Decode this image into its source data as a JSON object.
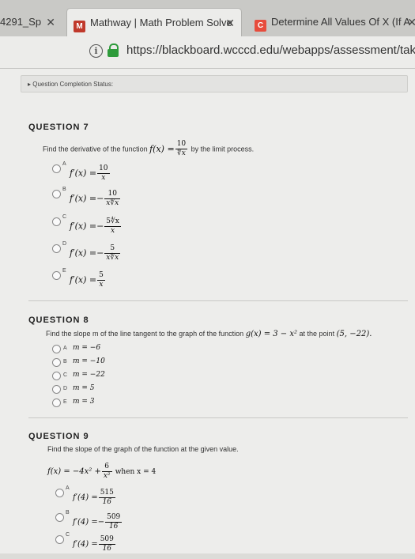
{
  "browser": {
    "tabs": [
      {
        "label": "4291_Sp",
        "close": "✕"
      },
      {
        "label": "Mathway | Math Problem Solve",
        "favicon": "M",
        "close": "✕"
      },
      {
        "label": "Determine All Values Of X (If A",
        "favicon": "C",
        "close": "✕"
      }
    ],
    "url": "https://blackboard.wcccd.edu/webapps/assessment/take/l"
  },
  "status_bar": "▸ Question Completion Status:",
  "q7": {
    "heading": "QUESTION 7",
    "prompt_before": "Find the derivative of the function",
    "func_lhs": "f(x) =",
    "func_num": "10",
    "func_den": "∜x",
    "prompt_after": "by the limit process.",
    "options": [
      {
        "letter": "A",
        "lhs": "f′(x) =",
        "sign": "",
        "num": "10",
        "den": "x"
      },
      {
        "letter": "B",
        "lhs": "f′(x) =",
        "sign": "−",
        "num": "10",
        "den": "x∜x"
      },
      {
        "letter": "C",
        "lhs": "f′(x) =",
        "sign": "−",
        "num": "5∜x",
        "den": "x"
      },
      {
        "letter": "D",
        "lhs": "f′(x) =",
        "sign": "−",
        "num": "5",
        "den": "x∜x"
      },
      {
        "letter": "E",
        "lhs": "f′(x) =",
        "sign": "",
        "num": "5",
        "den": "x"
      }
    ]
  },
  "q8": {
    "heading": "QUESTION 8",
    "prompt": "Find the slope m of the line tangent to the graph of the function",
    "func": "g(x) = 3 − x²",
    "at_point": "at the point",
    "point": "(5, −22).",
    "options": [
      {
        "letter": "A",
        "text": "m = −6"
      },
      {
        "letter": "B",
        "text": "m = −10"
      },
      {
        "letter": "C",
        "text": "m = −22"
      },
      {
        "letter": "D",
        "text": "m = 5"
      },
      {
        "letter": "E",
        "text": "m = 3"
      }
    ]
  },
  "q9": {
    "heading": "QUESTION 9",
    "prompt": "Find the slope of the graph of the function at the given value.",
    "func_lhs": "f(x) = −4x² +",
    "func_num": "6",
    "func_den": "x²",
    "when": "when x = 4",
    "options": [
      {
        "letter": "A",
        "lhs": "f′(4) =",
        "sign": "",
        "num": "515",
        "den": "16"
      },
      {
        "letter": "B",
        "lhs": "f′(4) =",
        "sign": "−",
        "num": "509",
        "den": "16"
      },
      {
        "letter": "C",
        "lhs": "f′(4) =",
        "sign": "",
        "num": "509",
        "den": "16"
      }
    ]
  }
}
